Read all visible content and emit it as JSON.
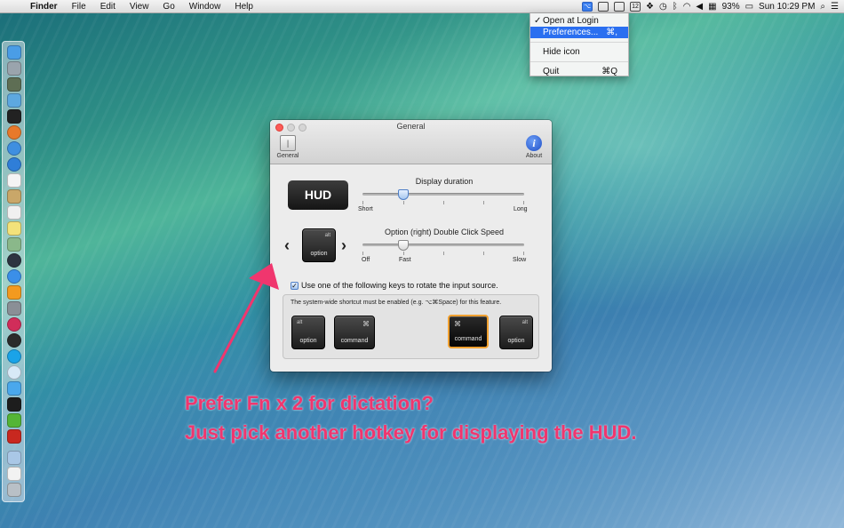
{
  "menubar": {
    "apple_icon": "apple-icon",
    "items": [
      "Finder",
      "File",
      "Edit",
      "View",
      "Go",
      "Window",
      "Help"
    ],
    "status": {
      "icons": [
        "app-status-icon",
        "airplay-icon",
        "screen-icon",
        "calendar-icon",
        "dropbox-icon",
        "time-machine-icon",
        "bluetooth-icon",
        "wifi-icon",
        "volume-icon",
        "flag-icon"
      ],
      "calendar_day": "12",
      "battery_percent": "93%",
      "clock": "Sun 10:29 PM"
    }
  },
  "dropdown": {
    "items": [
      {
        "label": "Open at Login",
        "checked": true,
        "shortcut": ""
      },
      {
        "label": "Preferences...",
        "checked": false,
        "shortcut": "⌘,",
        "selected": true
      },
      {
        "label": "Hide icon",
        "checked": false,
        "shortcut": ""
      },
      {
        "label": "Quit",
        "checked": false,
        "shortcut": "⌘Q"
      }
    ],
    "check_mark": "✓"
  },
  "window": {
    "title": "General",
    "toolbar": {
      "general_label": "General",
      "about_label": "About"
    },
    "hud_badge": "HUD",
    "display_duration": {
      "title": "Display duration",
      "min_label": "Short",
      "max_label": "Long",
      "value": 0.25
    },
    "double_click": {
      "title": "Option (right) Double Click Speed",
      "off_label": "Off",
      "fast_label": "Fast",
      "slow_label": "Slow",
      "value": 0.25
    },
    "key_selector": {
      "prev_arrow": "‹",
      "next_arrow": "›",
      "key_top": "alt",
      "key_name": "option"
    },
    "rotate_checkbox": {
      "checked": true,
      "label": "Use one of the following keys to rotate the input source."
    },
    "note": "The system-wide shortcut must be enabled (e.g. ⌥⌘Space) for this feature.",
    "keys": [
      {
        "top": "alt",
        "name": "option",
        "selected": false
      },
      {
        "top": "⌘",
        "name": "command",
        "selected": false
      },
      {
        "top": "⌘",
        "name": "command",
        "selected": true
      },
      {
        "top": "alt",
        "name": "option",
        "selected": false
      }
    ]
  },
  "captions": [
    "Prefer Fn x 2 for dictation?",
    "Just pick another hotkey for displaying the HUD."
  ],
  "colors": {
    "caption": "#f0366e",
    "arrow": "#f0366e",
    "menu_selection": "#2a6ff0",
    "selected_key_border": "#f0a030"
  }
}
